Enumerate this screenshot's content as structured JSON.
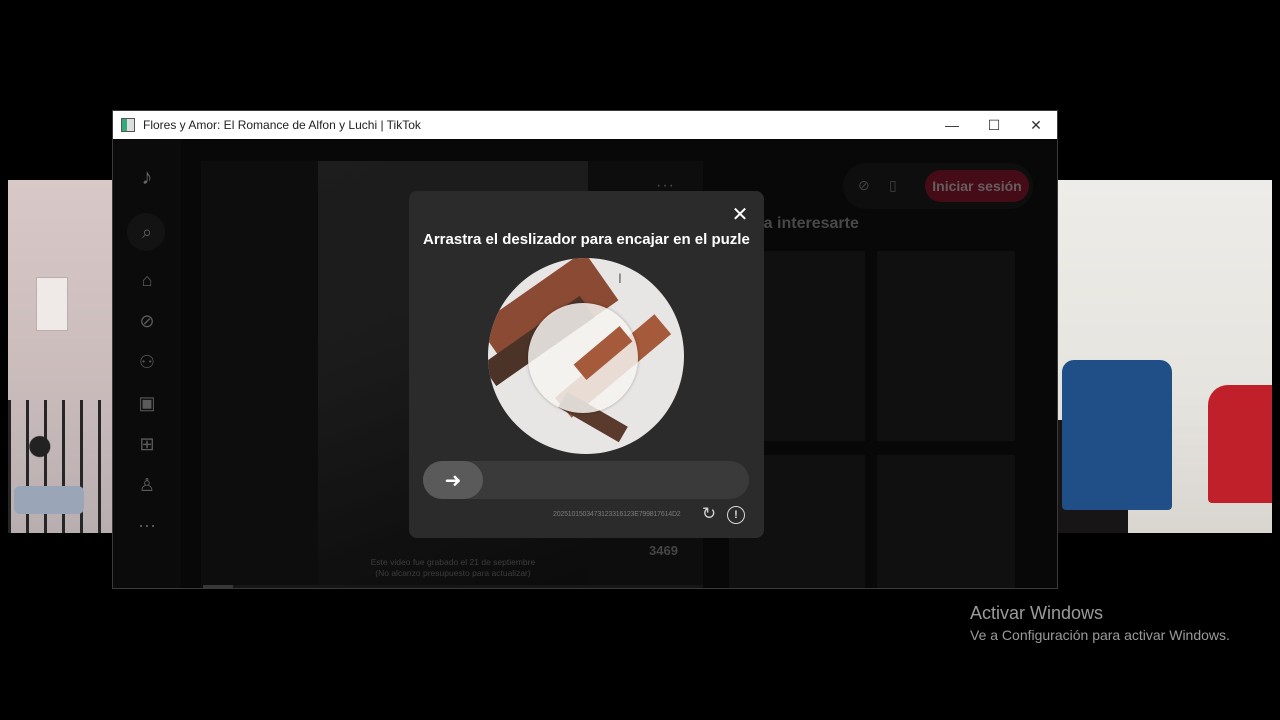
{
  "window": {
    "title": "Flores y Amor: El Romance de Alfon y Luchi | TikTok",
    "minimize": "—",
    "maximize": "☐",
    "close": "✕"
  },
  "sidebar": {
    "icons": [
      "tiktok-logo-icon",
      "search-icon",
      "home-icon",
      "explore-icon",
      "following-icon",
      "live-icon",
      "upload-icon",
      "profile-icon",
      "more-icon"
    ]
  },
  "video": {
    "caption_line1": "Este video fue grabado el 21 de septiembre",
    "caption_line2": "(No alcanzo presupuesto para actualizar)",
    "likes": "3469",
    "more": "···"
  },
  "right_panel": {
    "title": "ría interesarte",
    "login_button": "Iniciar sesión"
  },
  "captcha": {
    "title": "Arrastra el deslizador para encajar en el puzle",
    "close": "✕",
    "slider_arrow": "➜",
    "id_text": "2025101503473123316123E799817614D2",
    "refresh": "↻",
    "info": "!"
  },
  "windows_activation": {
    "line1": "Activar Windows",
    "line2": "Ve a Configuración para activar Windows."
  },
  "colors": {
    "login_button_bg": "#6b1326",
    "captcha_bg": "#2b2b2b"
  }
}
